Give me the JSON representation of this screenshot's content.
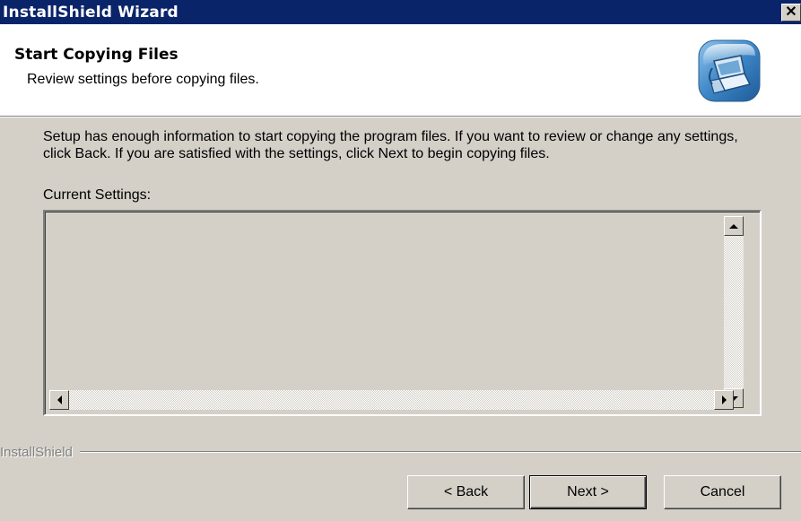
{
  "window": {
    "title": "InstallShield Wizard",
    "close_glyph": "✕"
  },
  "header": {
    "title": "Start Copying Files",
    "subtitle": "Review settings before copying files.",
    "icon": "computer-install-icon"
  },
  "body": {
    "description": "Setup has enough information to start copying the program files.  If you want to review or change any settings, click Back.  If you are satisfied with the settings, click Next to begin copying files.",
    "current_settings_label": "Current Settings:",
    "current_settings_value": ""
  },
  "footer": {
    "brand": "InstallShield"
  },
  "buttons": {
    "back": "< Back",
    "next": "Next >",
    "cancel": "Cancel"
  },
  "colors": {
    "titlebar": "#0a246a",
    "dialog_bg": "#d4d0c8",
    "header_bg": "#ffffff"
  }
}
